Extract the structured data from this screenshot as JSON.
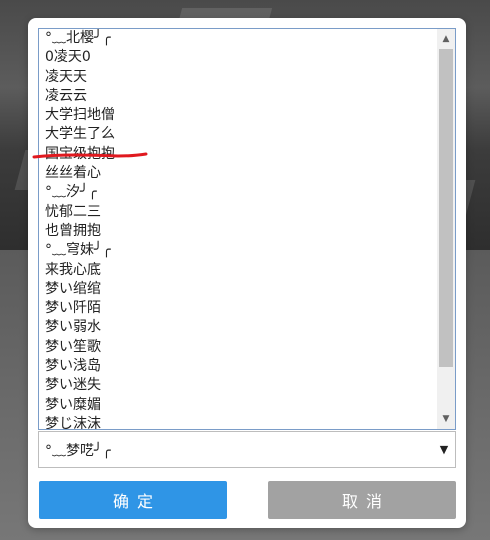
{
  "list": {
    "items": [
      "°﹏北樱╯╭",
      "0凌天0",
      "凌天天",
      "凌云云",
      "大学扫地僧",
      "大学生了么",
      "国宝级抱抱",
      "丝丝着心",
      "°﹏汐╯╭",
      "忧郁二三",
      "也曾拥抱",
      "°﹏穹妹╯╭",
      "来我心底",
      "梦い绾绾",
      "梦い阡陌",
      "梦い弱水",
      "梦い笙歌",
      "梦い浅岛",
      "梦い迷失",
      "梦い糜媚",
      "梦じ沫沫"
    ],
    "highlighted_item": "国宝级抱抱",
    "annotation_color": "#e0191f"
  },
  "select": {
    "value": "°﹏梦呓╯╭",
    "arrow": "▼"
  },
  "scrollbar": {
    "up_arrow": "▲",
    "down_arrow": "▼"
  },
  "buttons": {
    "ok_label": "确定",
    "cancel_label": "取消",
    "ok_color": "#2f95e6",
    "cancel_color": "#a2a2a2"
  }
}
